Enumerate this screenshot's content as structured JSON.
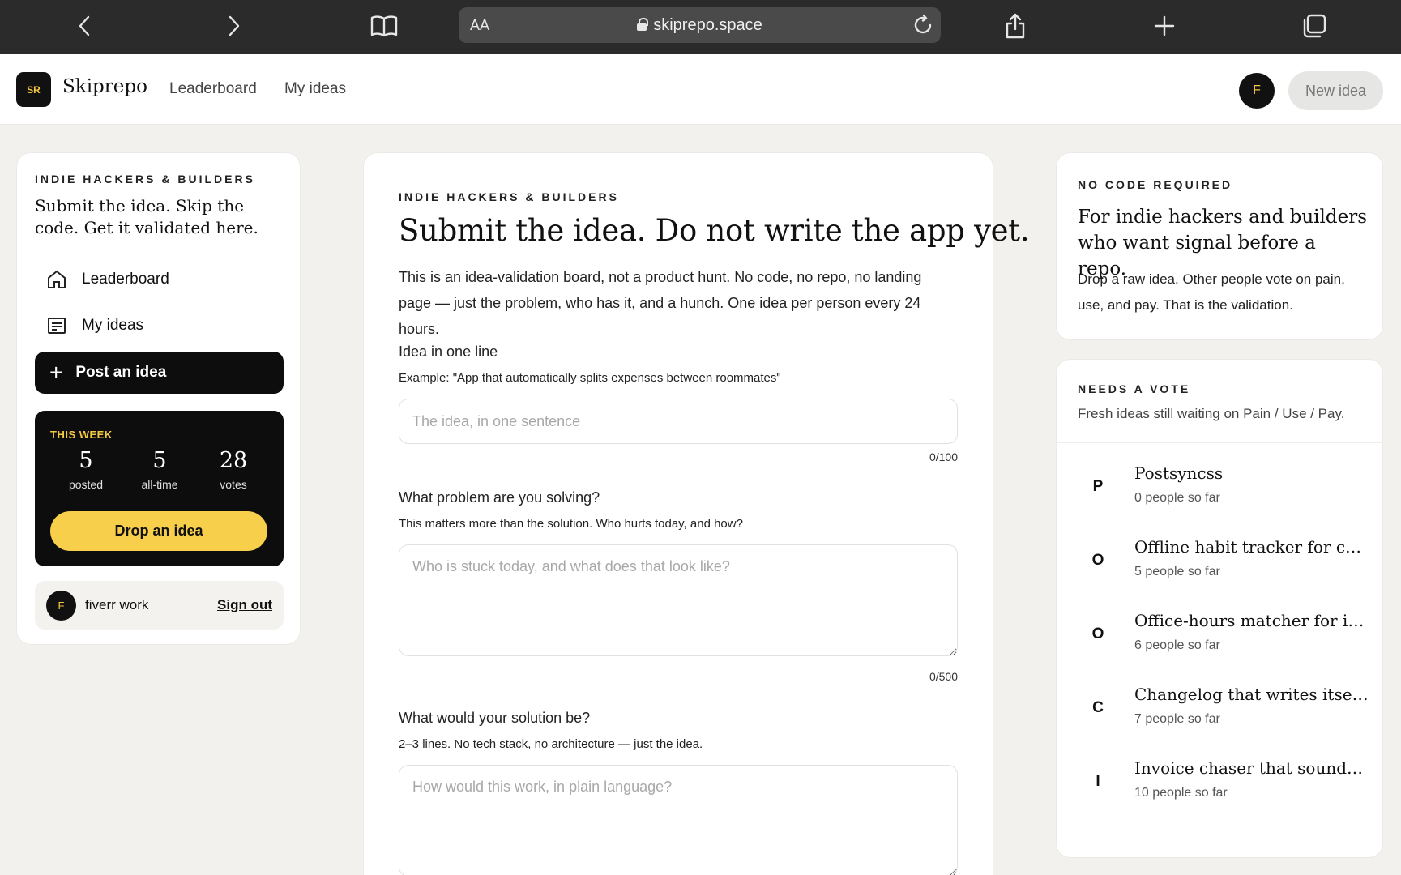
{
  "browser": {
    "text_size_label": "AA",
    "url": "skiprepo.space"
  },
  "header": {
    "logo_text": "SR",
    "brand": "Skiprepo",
    "nav": [
      "Leaderboard",
      "My ideas"
    ],
    "avatar_initial": "F",
    "new_idea_label": "New idea"
  },
  "sidebar": {
    "eyebrow": "INDIE HACKERS & BUILDERS",
    "tagline": "Submit the idea. Skip the code. Get it validated here.",
    "items": [
      {
        "label": "Leaderboard",
        "icon": "home-icon"
      },
      {
        "label": "My ideas",
        "icon": "list-icon"
      }
    ],
    "post_label": "Post an idea",
    "week": {
      "label": "THIS WEEK",
      "stats": [
        {
          "num": "5",
          "label": "posted"
        },
        {
          "num": "5",
          "label": "all-time"
        },
        {
          "num": "28",
          "label": "votes"
        }
      ],
      "cta": "Drop an idea"
    },
    "user": {
      "initial": "F",
      "name": "fiverr work",
      "sign_out": "Sign out"
    }
  },
  "main": {
    "eyebrow": "INDIE HACKERS & BUILDERS",
    "title": "Submit the idea. Do not write the app yet.",
    "intro": "This is an idea-validation board, not a product hunt. No code, no repo, no landing page — just the problem, who has it, and a hunch. One idea per person every 24 hours.",
    "fields": [
      {
        "label": "Idea in one line",
        "hint": "Example: \"App that automatically splits expenses between roommates\"",
        "placeholder": "The idea, in one sentence",
        "counter": "0/100"
      },
      {
        "label": "What problem are you solving?",
        "hint": "This matters more than the solution. Who hurts today, and how?",
        "placeholder": "Who is stuck today, and what does that look like?",
        "counter": "0/500"
      },
      {
        "label": "What would your solution be?",
        "hint": "2–3 lines. No tech stack, no architecture — just the idea.",
        "placeholder": "How would this work, in plain language?"
      }
    ]
  },
  "right": {
    "info": {
      "eyebrow": "NO CODE REQUIRED",
      "heading": "For indie hackers and builders who want signal before a repo.",
      "desc": "Drop a raw idea. Other people vote on pain, use, and pay. That is the validation."
    },
    "votes": {
      "eyebrow": "NEEDS A VOTE",
      "subtitle": "Fresh ideas still waiting on Pain / Use / Pay.",
      "items": [
        {
          "letter": "P",
          "title": "Postsyncss",
          "sub": "0 people so far"
        },
        {
          "letter": "O",
          "title": "Offline habit tracker for che...",
          "sub": "5 people so far"
        },
        {
          "letter": "O",
          "title": "Office-hours matcher for in...",
          "sub": "6 people so far"
        },
        {
          "letter": "C",
          "title": "Changelog that writes itself ...",
          "sub": "7 people so far"
        },
        {
          "letter": "I",
          "title": "Invoice chaser that sounds li...",
          "sub": "10 people so far"
        }
      ]
    }
  }
}
